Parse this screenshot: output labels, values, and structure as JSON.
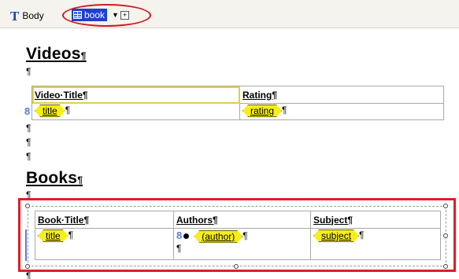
{
  "breadcrumb": {
    "body_label": "Body",
    "book_label": "book",
    "dropdown_glyph": "▼",
    "plus_glyph": "+"
  },
  "pilcrow": "¶",
  "videos": {
    "heading": "Videos",
    "columns": [
      "Video·Title¶",
      "Rating¶"
    ],
    "row": {
      "title_tag": "title",
      "rating_tag": "rating"
    }
  },
  "books": {
    "heading": "Books",
    "columns": [
      "Book·Title¶",
      "Authors¶",
      "Subject¶"
    ],
    "row": {
      "title_tag": "title",
      "author_tag": "(author)",
      "subject_tag": "subject"
    }
  },
  "colors": {
    "tag_fill": "#f6ee1a",
    "highlight": "#e01d24",
    "selection": "#1f3fce"
  }
}
